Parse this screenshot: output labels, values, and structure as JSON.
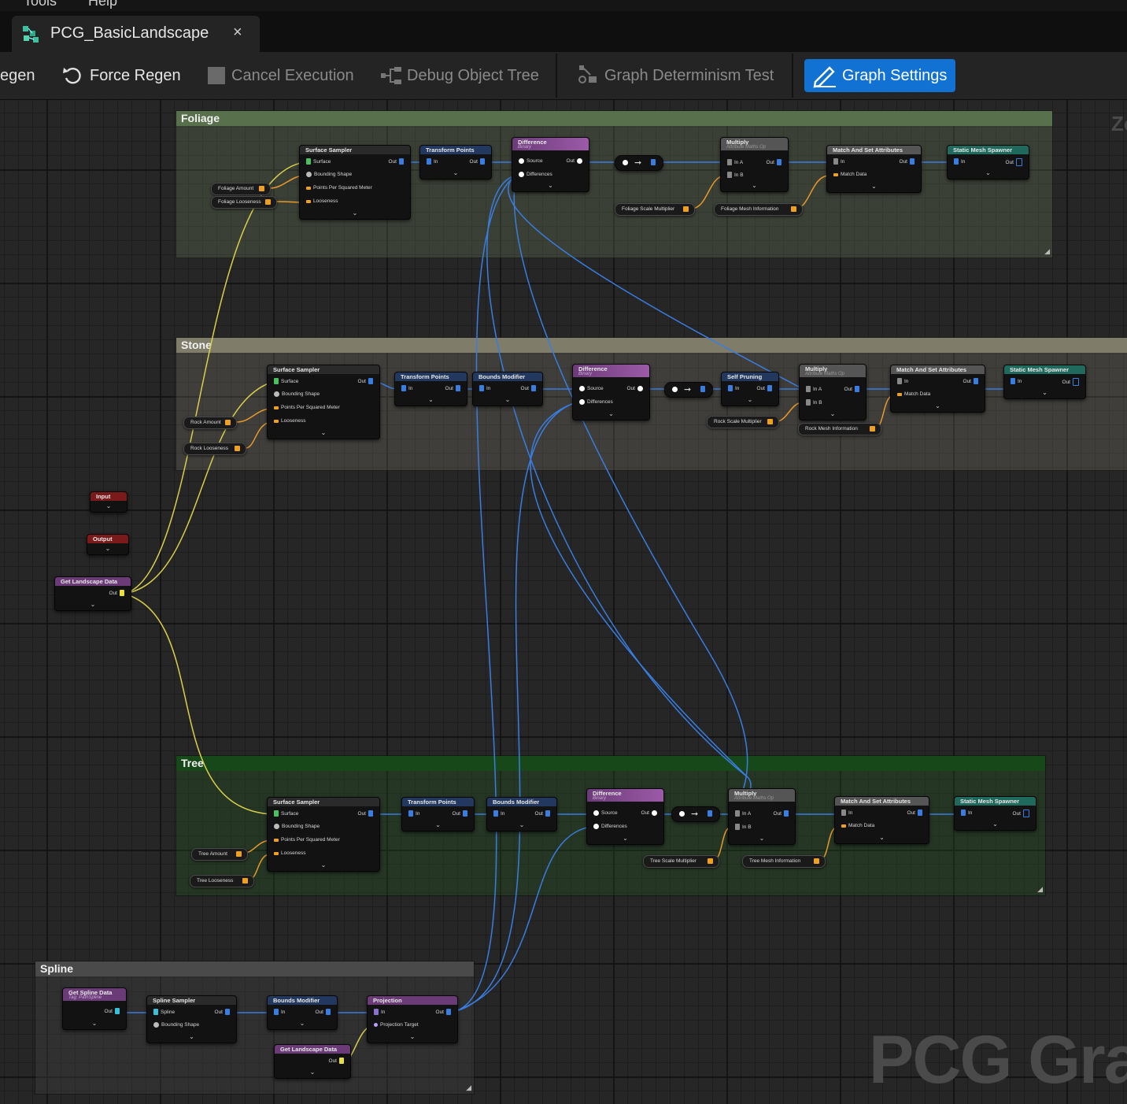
{
  "menu": [
    "Tools",
    "Help"
  ],
  "tab": {
    "title": "PCG_BasicLandscape",
    "close": "×"
  },
  "toolbar": {
    "regen": "egen",
    "force_regen": "Force Regen",
    "cancel_execution": "Cancel Execution",
    "debug_object_tree": "Debug Object Tree",
    "graph_determinism_test": "Graph Determinism Test",
    "graph_settings": "Graph Settings"
  },
  "colors": {
    "accent": "#1172d4",
    "wire_blue": "#3a7de0",
    "wire_yellow": "#d8d04a",
    "wire_orange": "#e89a2a"
  },
  "graph": {
    "watermark": "PCG Grap",
    "zoom_label": "Zo",
    "comments": {
      "foliage": "Foliage",
      "stone": "Stone",
      "tree": "Tree",
      "spline": "Spline"
    },
    "labels": {
      "surface_sampler": "Surface Sampler",
      "transform_points": "Transform Points",
      "bounds_modifier": "Bounds Modifier",
      "difference": "Difference",
      "binary": "Binary",
      "self_pruning": "Self Pruning",
      "multiply": "Multiply",
      "attribute_maths_op": "Attribute Maths Op",
      "match_and_set": "Match And Set Attributes",
      "static_mesh_spawner": "Static Mesh Spawner",
      "input": "Input",
      "output": "Output",
      "get_landscape_data": "Get Landscape Data",
      "get_spline_data": "Get Spline Data",
      "tag_pathspline": "Tag: PathSpline",
      "spline_sampler": "Spline Sampler",
      "projection": "Projection",
      "out": "Out",
      "in": "In",
      "in_a": "In A",
      "in_b": "In B",
      "surface": "Surface",
      "bounding_shape": "Bounding Shape",
      "points_per_sq_meter": "Points Per Squared Meter",
      "looseness": "Looseness",
      "source": "Source",
      "differences": "Differences",
      "match_data": "Match Data",
      "spline": "Spline",
      "projection_target": "Projection Target"
    },
    "params": {
      "foliage_amount": "Foliage Amount",
      "foliage_looseness": "Foliage Looseness",
      "foliage_scale": "Foliage Scale Multiplier",
      "foliage_mesh": "Foliage Mesh Information",
      "rock_amount": "Rock Amount",
      "rock_looseness": "Rock Looseness",
      "rock_scale": "Rock Scale Multiplier",
      "rock_mesh": "Rock Mesh Information",
      "tree_amount": "Tree Amount",
      "tree_looseness": "Tree Looseness",
      "tree_scale": "Tree Scale Multiplier",
      "tree_mesh": "Tree Mesh Information"
    }
  }
}
